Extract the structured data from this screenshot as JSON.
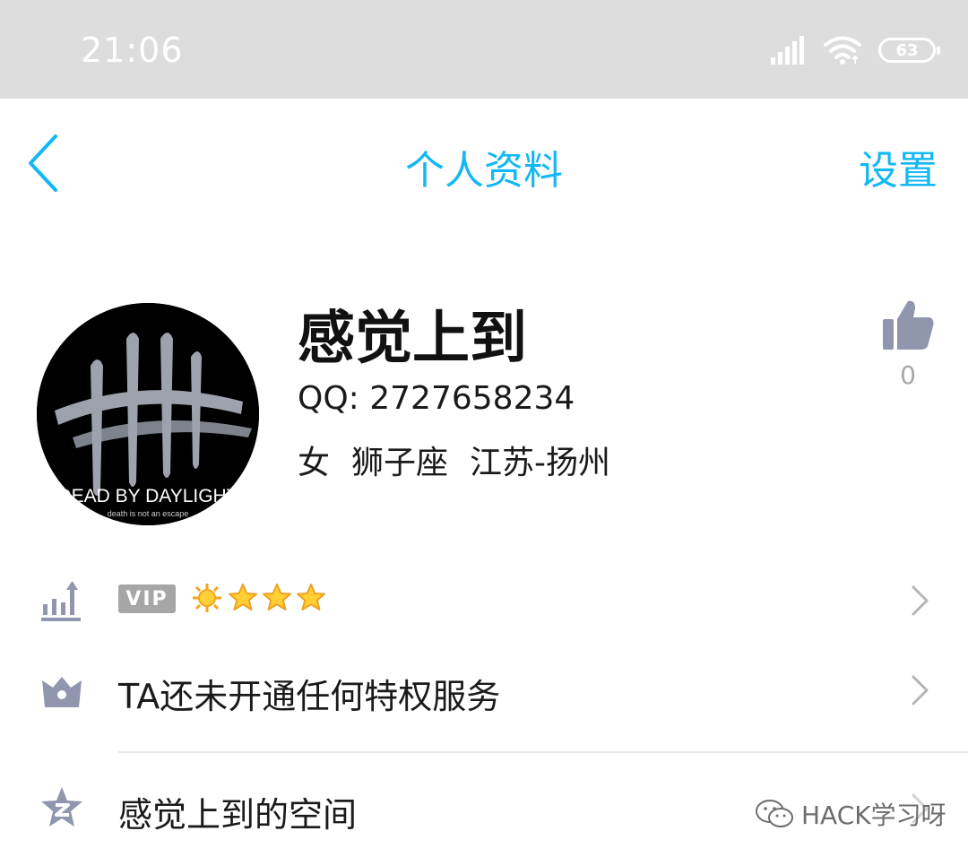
{
  "status_bar": {
    "time": "21:06",
    "battery": "63"
  },
  "nav": {
    "title": "个人资料",
    "settings": "设置"
  },
  "profile": {
    "nickname": "感觉上到",
    "qq": "QQ: 2727658234",
    "gender": "女",
    "zodiac": "狮子座",
    "location": "江苏-扬州",
    "likes": "0",
    "avatar_text": "DEAD BY DAYLIGHT",
    "avatar_subtext": "death is not an escape"
  },
  "rows": {
    "level": {
      "vip_badge": "VIP",
      "level_icons": [
        "sun-icon",
        "star-icon",
        "star-icon",
        "star-icon"
      ]
    },
    "privilege": {
      "label": "TA还未开通任何特权服务"
    },
    "space": {
      "label": "感觉上到的空间"
    }
  },
  "watermark": {
    "text": "HACK学习呀"
  },
  "colors": {
    "accent": "#12b7f5",
    "icon_gray": "#8f96ad",
    "status_bar": "#dddddd"
  }
}
